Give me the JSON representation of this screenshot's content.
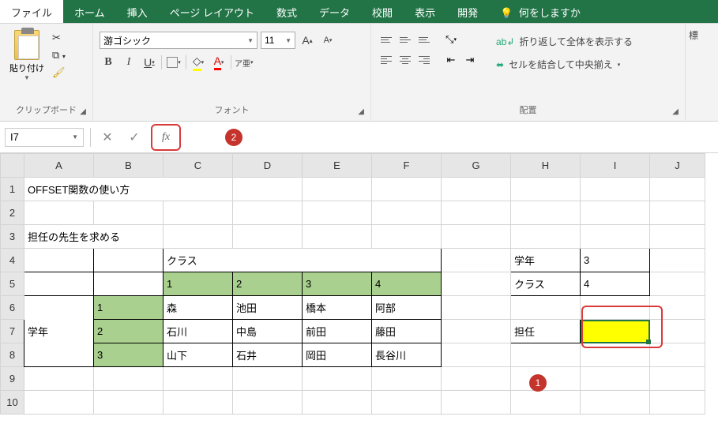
{
  "menu": {
    "file": "ファイル",
    "home": "ホーム",
    "insert": "挿入",
    "page_layout": "ページ レイアウト",
    "formulas": "数式",
    "data": "データ",
    "review": "校閲",
    "view": "表示",
    "developer": "開発",
    "tell_me": "何をしますか"
  },
  "ribbon": {
    "clipboard": {
      "label": "クリップボード",
      "paste": "貼り付け"
    },
    "font": {
      "label": "フォント",
      "name": "游ゴシック",
      "size": "11",
      "bold": "B",
      "italic": "I",
      "underline": "U",
      "increase": "A",
      "decrease": "A",
      "furigana": "ア亜"
    },
    "alignment": {
      "label": "配置",
      "wrap": "折り返して全体を表示する",
      "merge": "セルを結合して中央揃え"
    },
    "standard": "標"
  },
  "formula_bar": {
    "name_box": "I7",
    "fx": "fx"
  },
  "callouts": {
    "c1": "1",
    "c2": "2"
  },
  "columns": [
    "A",
    "B",
    "C",
    "D",
    "E",
    "F",
    "G",
    "H",
    "I",
    "J"
  ],
  "rows": [
    "1",
    "2",
    "3",
    "4",
    "5",
    "6",
    "7",
    "8",
    "9",
    "10"
  ],
  "cells": {
    "a1": "OFFSET関数の使い方",
    "a3": "担任の先生を求める",
    "c4": "クラス",
    "c5": "1",
    "d5": "2",
    "e5": "3",
    "f5": "4",
    "a6": "学年",
    "b6": "1",
    "c6": "森",
    "d6": "池田",
    "e6": "橋本",
    "f6": "阿部",
    "b7": "2",
    "c7": "石川",
    "d7": "中島",
    "e7": "前田",
    "f7": "藤田",
    "b8": "3",
    "c8": "山下",
    "d8": "石井",
    "e8": "岡田",
    "f8": "長谷川",
    "h4_label": "学年",
    "i4_val": "3",
    "h5_label": "クラス",
    "i5_val": "4",
    "h7_label": "担任"
  }
}
